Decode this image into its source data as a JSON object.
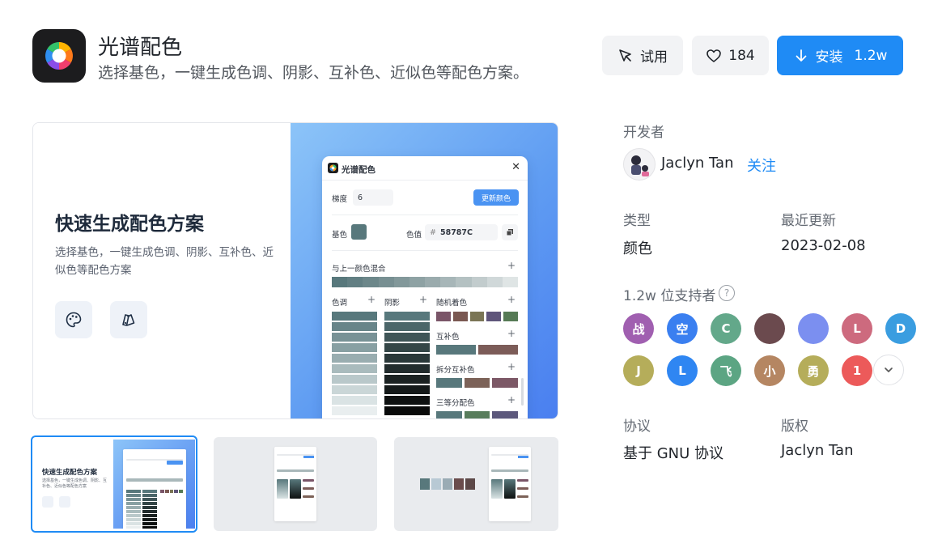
{
  "app": {
    "name": "光谱配色",
    "description": "选择基色，一键生成色调、阴影、互补色、近似色等配色方案。"
  },
  "actions": {
    "try_label": "试用",
    "like_count": "184",
    "install_label": "安装",
    "install_count": "1.2w",
    "accent_color": "#1f8bf5"
  },
  "preview": {
    "heading": "快速生成配色方案",
    "subtitle": "选择基色，一键生成色调、阴影、互补色、近似色等配色方案",
    "icons": [
      "palette-icon",
      "swatch-icon"
    ],
    "card": {
      "title": "光谱配色",
      "gradient_label": "梯度",
      "gradient_value": "6",
      "update_button": "更新颜色",
      "base_label": "基色",
      "color_value_label": "色值",
      "hex_prefix": "#",
      "hex_value": "58787C",
      "mix_label": "与上一颜色混合",
      "tone_label": "色调",
      "shade_label": "阴影",
      "random_label": "随机着色",
      "complement_label": "互补色",
      "split_label": "拆分互补色",
      "triad_label": "三等分配色",
      "base_color": "#58787c",
      "mix_colors": [
        "#58787c",
        "#627f83",
        "#6c878a",
        "#778f92",
        "#82989a",
        "#8ea2a4",
        "#9aabad",
        "#a7b6b8",
        "#b4c1c2",
        "#c2cccd",
        "#d0d8d9",
        "#dfe5e5"
      ],
      "tone_colors": [
        "#58787c",
        "#688589",
        "#789296",
        "#88a0a3",
        "#99adb0",
        "#a9bbbd",
        "#b9c8ca",
        "#cad6d7",
        "#dae3e4",
        "#e9eeef"
      ],
      "shade_colors": [
        "#58787c",
        "#4b6669",
        "#3f5557",
        "#344647",
        "#2a3839",
        "#222c2d",
        "#1b2222",
        "#141919",
        "#0e1111",
        "#090a0a"
      ],
      "random_colors": [
        "#7a5568",
        "#7a5852",
        "#7a7555",
        "#5f557a",
        "#567a55"
      ],
      "complement_colors": [
        "#58787c",
        "#7c5c58"
      ],
      "split_colors": [
        "#58787c",
        "#7c6258",
        "#7c5866"
      ],
      "triad_colors": [
        "#58787c",
        "#587c5c",
        "#5c587c"
      ]
    }
  },
  "thumbnails": {
    "swatches": [
      "#58787c",
      "#b8c9d4",
      "#9aabb4",
      "#6a4c4c",
      "#5c4848"
    ]
  },
  "sidebar": {
    "developer_label": "开发者",
    "developer_name": "Jaclyn Tan",
    "follow_label": "关注",
    "type_label": "类型",
    "type_value": "颜色",
    "updated_label": "最近更新",
    "updated_value": "2023-02-08",
    "supporters_label": "1.2w 位支持者",
    "supporters": [
      {
        "text": "战",
        "color": "#a05fb0"
      },
      {
        "text": "空",
        "color": "#3a7ff0"
      },
      {
        "text": "C",
        "color": "#63a88a"
      },
      {
        "text": "",
        "color": "#6b4a4e"
      },
      {
        "text": "",
        "color": "#7b8ff0"
      },
      {
        "text": "L",
        "color": "#cd6a7e"
      },
      {
        "text": "D",
        "color": "#3a9de0"
      },
      {
        "text": "J",
        "color": "#b5ad5a"
      },
      {
        "text": "L",
        "color": "#2f86f2"
      },
      {
        "text": "飞",
        "color": "#5ca583"
      },
      {
        "text": "小",
        "color": "#b58662"
      },
      {
        "text": "勇",
        "color": "#b5ad5a"
      },
      {
        "text": "1",
        "color": "#ec5a5a"
      }
    ],
    "license_label": "协议",
    "license_value": "基于 GNU 协议",
    "copyright_label": "版权",
    "copyright_value": "Jaclyn Tan"
  }
}
